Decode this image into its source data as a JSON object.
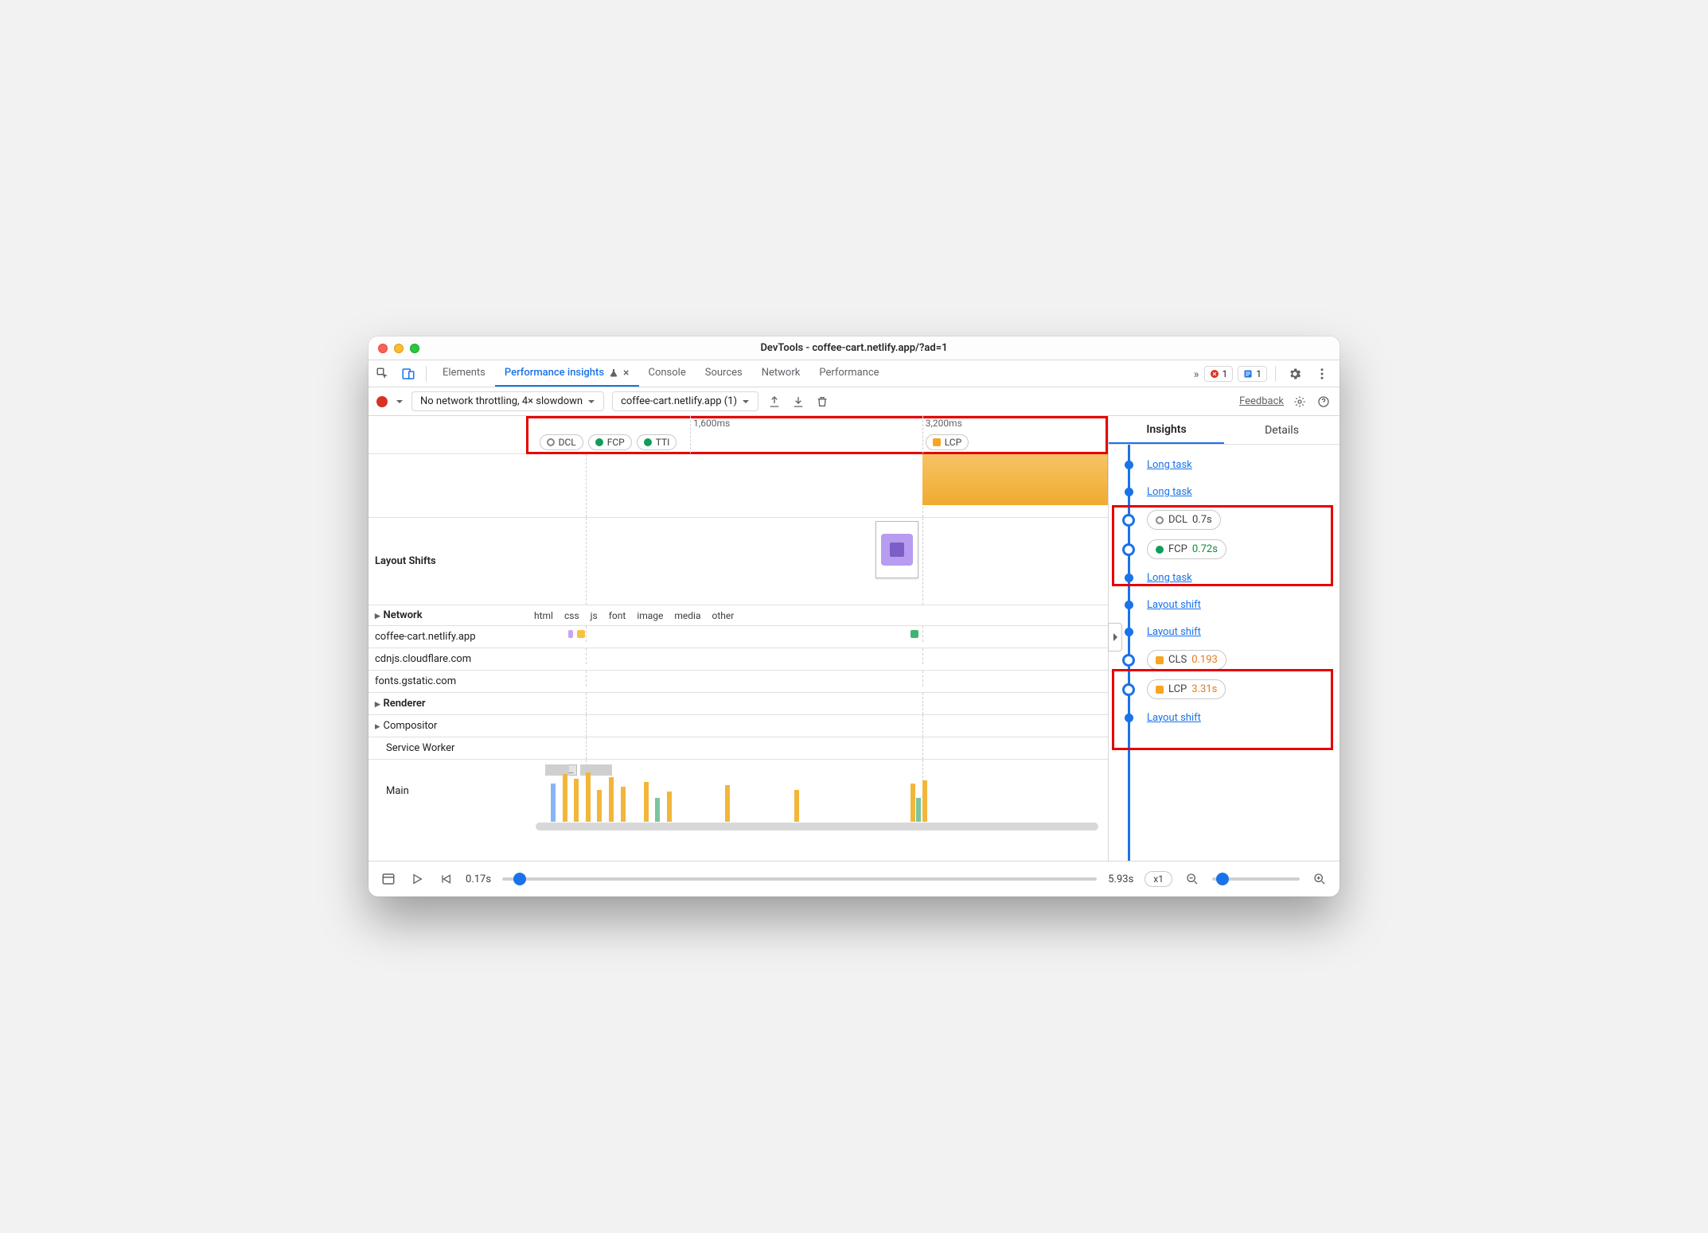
{
  "window": {
    "title": "DevTools - coffee-cart.netlify.app/?ad=1"
  },
  "tabs": {
    "items": [
      "Elements",
      "Performance insights",
      "Console",
      "Sources",
      "Network",
      "Performance"
    ],
    "active_index": 1,
    "overflow_glyph": "»",
    "error_count": "1",
    "info_count": "1"
  },
  "toolbar": {
    "throttling": "No network throttling, 4× slowdown",
    "capture": "coffee-cart.netlify.app (1)",
    "feedback": "Feedback"
  },
  "timeline": {
    "ticks": [
      "1,600ms",
      "3,200ms"
    ],
    "marker_groups": [
      {
        "items": [
          {
            "label": "DCL",
            "shape": "ring",
            "color": "#888"
          },
          {
            "label": "FCP",
            "shape": "dot",
            "color": "#0f9d58"
          },
          {
            "label": "TTI",
            "shape": "dot",
            "color": "#0f9d58"
          }
        ]
      },
      {
        "items": [
          {
            "label": "LCP",
            "shape": "square",
            "color": "#f5a623"
          }
        ]
      }
    ],
    "rows": {
      "layout_shifts": "Layout Shifts",
      "network": "Network",
      "renderer": "Renderer",
      "compositor": "Compositor",
      "service_worker": "Service Worker",
      "main": "Main"
    },
    "legend": [
      {
        "label": "html",
        "class": "c-html"
      },
      {
        "label": "css",
        "class": "c-css"
      },
      {
        "label": "js",
        "class": "c-js"
      },
      {
        "label": "font",
        "class": "c-font"
      },
      {
        "label": "image",
        "class": "c-image"
      },
      {
        "label": "media",
        "class": "c-media"
      },
      {
        "label": "other",
        "class": "c-other"
      }
    ],
    "network_rows": [
      "coffee-cart.netlify.app",
      "cdnjs.cloudflare.com",
      "fonts.gstatic.com"
    ],
    "main_more": "..."
  },
  "right": {
    "tabs": [
      "Insights",
      "Details"
    ],
    "active_index": 0,
    "items": [
      {
        "kind": "link",
        "label": "Long task"
      },
      {
        "kind": "link",
        "label": "Long task"
      },
      {
        "kind": "pill",
        "marker": "ring",
        "marker_color": "#888",
        "label": "DCL",
        "value": "0.7s",
        "value_class": ""
      },
      {
        "kind": "pill",
        "marker": "dot",
        "marker_color": "#0f9d58",
        "label": "FCP",
        "value": "0.72s",
        "value_class": "val-green"
      },
      {
        "kind": "link",
        "label": "Long task"
      },
      {
        "kind": "link",
        "label": "Layout shift"
      },
      {
        "kind": "link",
        "label": "Layout shift"
      },
      {
        "kind": "pill",
        "marker": "square",
        "marker_color": "#f5a623",
        "label": "CLS",
        "value": "0.193",
        "value_class": "val-orange"
      },
      {
        "kind": "pill",
        "marker": "square",
        "marker_color": "#f5a623",
        "label": "LCP",
        "value": "3.31s",
        "value_class": "val-orange"
      },
      {
        "kind": "link",
        "label": "Layout shift"
      }
    ]
  },
  "scrubber": {
    "start": "0.17s",
    "end": "5.93s",
    "speed": "x1"
  }
}
